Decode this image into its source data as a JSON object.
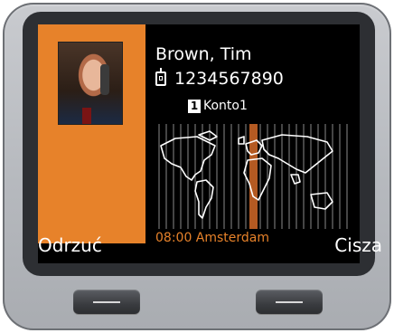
{
  "caller": {
    "name": "Brown, Tim",
    "number": "1234567890"
  },
  "account": {
    "index": "1",
    "label": "Konto1"
  },
  "world_clock": {
    "time_city": "08:00 Amsterdam"
  },
  "softkeys": {
    "left": "Odrzuć",
    "right": "Cisza"
  },
  "icons": {
    "number_type": "handset-icon"
  },
  "colors": {
    "accent": "#e7822a",
    "screen_bg": "#000000",
    "text": "#ffffff"
  }
}
